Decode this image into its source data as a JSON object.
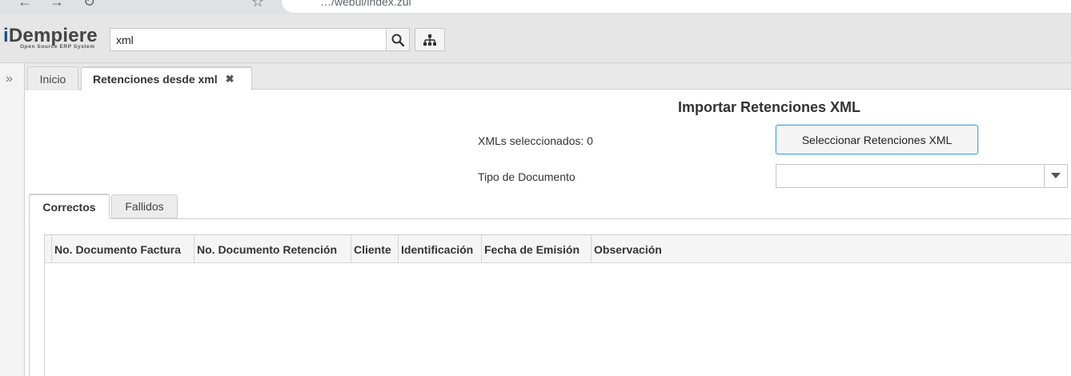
{
  "browser": {
    "url": "…/webui/index.zul"
  },
  "header": {
    "logo_main_prefix": "i",
    "logo_main_rest": "Dempiere",
    "logo_sub": "Open Source ERP System",
    "search_value": "xml"
  },
  "tabs": [
    {
      "label": "Inicio"
    },
    {
      "label": "Retenciones desde xml",
      "close": "✖"
    }
  ],
  "form": {
    "title": "Importar Retenciones XML",
    "xml_count_label": "XMLs seleccionados: 0",
    "select_button_label": "Seleccionar Retenciones XML",
    "doctype_label": "Tipo de Documento",
    "doctype_value": ""
  },
  "subtabs": [
    {
      "label": "Correctos"
    },
    {
      "label": "Fallidos"
    }
  ],
  "grid": {
    "columns": [
      "No. Documento Factura",
      "No. Documento Retención",
      "Cliente",
      "Identificación",
      "Fecha de Emisión",
      "Observación"
    ],
    "rows": []
  },
  "colors": {
    "accent": "#44a5e3",
    "logo_blue": "#1d4f91",
    "header_bg": "#e6e6e6"
  }
}
